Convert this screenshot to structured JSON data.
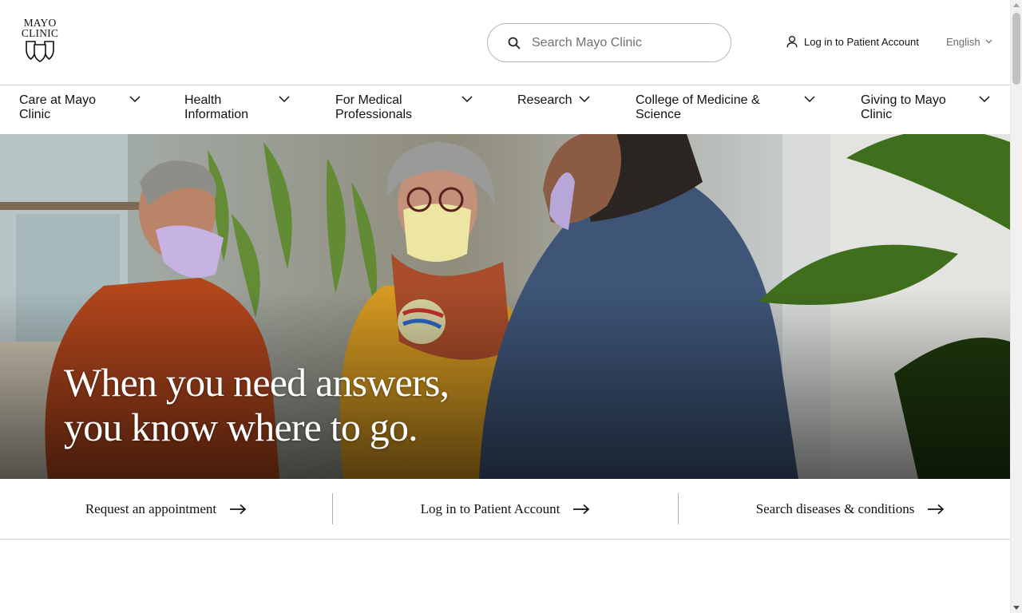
{
  "header": {
    "logo_line1": "MAYO",
    "logo_line2": "CLINIC",
    "search_placeholder": "Search Mayo Clinic",
    "account_label": "Log in to Patient Account",
    "language_label": "English"
  },
  "nav": {
    "items": [
      {
        "line1": "Care at Mayo",
        "line2": "Clinic"
      },
      {
        "line1": "Health",
        "line2": "Information"
      },
      {
        "line1": "For Medical",
        "line2": "Professionals"
      },
      {
        "line1": "Research",
        "line2": ""
      },
      {
        "line1": "College of Medicine &",
        "line2": "Science"
      },
      {
        "line1": "Giving to Mayo",
        "line2": "Clinic"
      }
    ]
  },
  "hero": {
    "title_line1": "When you need answers,",
    "title_line2": "you know where to go."
  },
  "quick_links": [
    {
      "label": "Request an appointment"
    },
    {
      "label": "Log in to Patient Account"
    },
    {
      "label": "Search diseases & conditions"
    }
  ],
  "colors": {
    "text": "#080808",
    "border": "#d0d0d0",
    "hero_text": "#ffffff"
  }
}
